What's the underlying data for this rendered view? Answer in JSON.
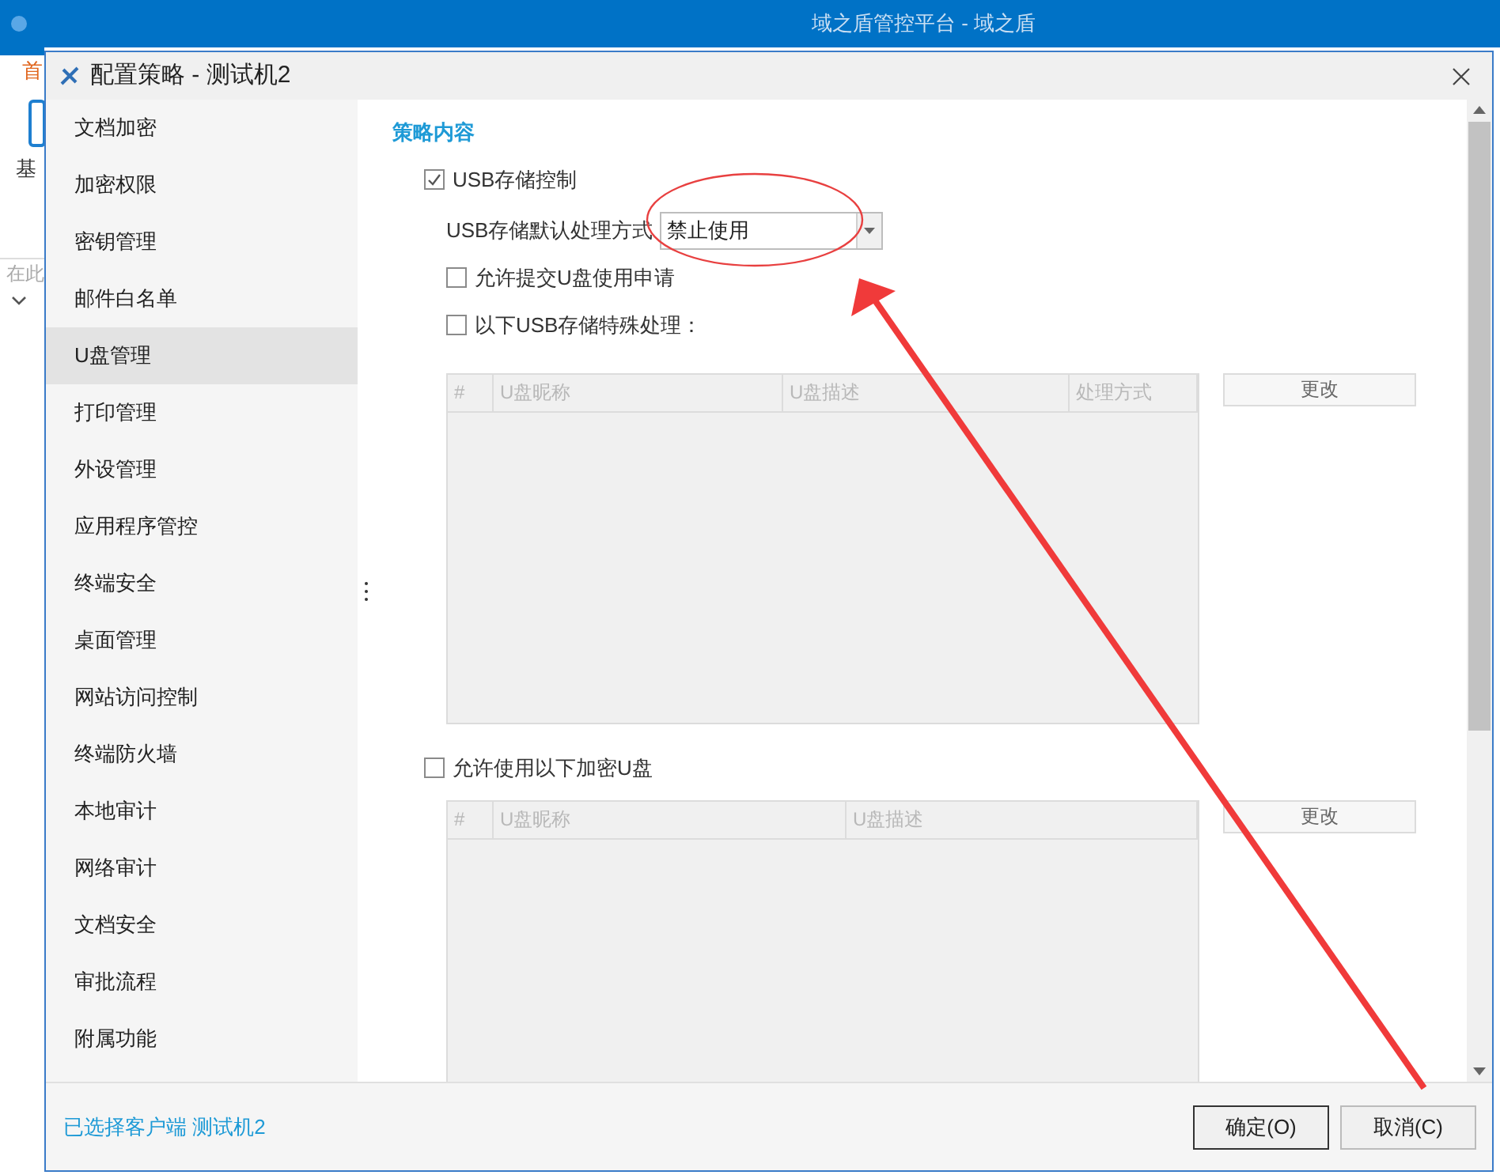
{
  "app": {
    "title": "域之盾管控平台 - 域之盾",
    "tab": "首",
    "tool": "基",
    "search": "在此"
  },
  "dialog": {
    "title": "配置策略 - 测试机2",
    "sidebar": [
      {
        "label": "文档加密",
        "selected": false
      },
      {
        "label": "加密权限",
        "selected": false
      },
      {
        "label": "密钥管理",
        "selected": false
      },
      {
        "label": "邮件白名单",
        "selected": false
      },
      {
        "label": "U盘管理",
        "selected": true
      },
      {
        "label": "打印管理",
        "selected": false
      },
      {
        "label": "外设管理",
        "selected": false
      },
      {
        "label": "应用程序管控",
        "selected": false
      },
      {
        "label": "终端安全",
        "selected": false
      },
      {
        "label": "桌面管理",
        "selected": false
      },
      {
        "label": "网站访问控制",
        "selected": false
      },
      {
        "label": "终端防火墙",
        "selected": false
      },
      {
        "label": "本地审计",
        "selected": false
      },
      {
        "label": "网络审计",
        "selected": false
      },
      {
        "label": "文档安全",
        "selected": false
      },
      {
        "label": "审批流程",
        "selected": false
      },
      {
        "label": "附属功能",
        "selected": false
      }
    ],
    "section_title": "策略内容",
    "usb_control": {
      "label": "USB存储控制",
      "checked": true
    },
    "default_action": {
      "label": "USB存储默认处理方式",
      "value": "禁止使用"
    },
    "options": [
      {
        "label": "允许提交U盘使用申请",
        "checked": false
      },
      {
        "label": "以下USB存储特殊处理：",
        "checked": false
      }
    ],
    "table1": {
      "columns": [
        "#",
        "U盘昵称",
        "U盘描述",
        "处理方式"
      ],
      "button": "更改"
    },
    "encrypted": {
      "label": "允许使用以下加密U盘",
      "checked": false
    },
    "table2": {
      "columns": [
        "#",
        "U盘昵称",
        "U盘描述"
      ],
      "button": "更改"
    },
    "footer": {
      "status": "已选择客户端 测试机2",
      "buttons": [
        "确定(O)",
        "取消(C)"
      ]
    }
  }
}
